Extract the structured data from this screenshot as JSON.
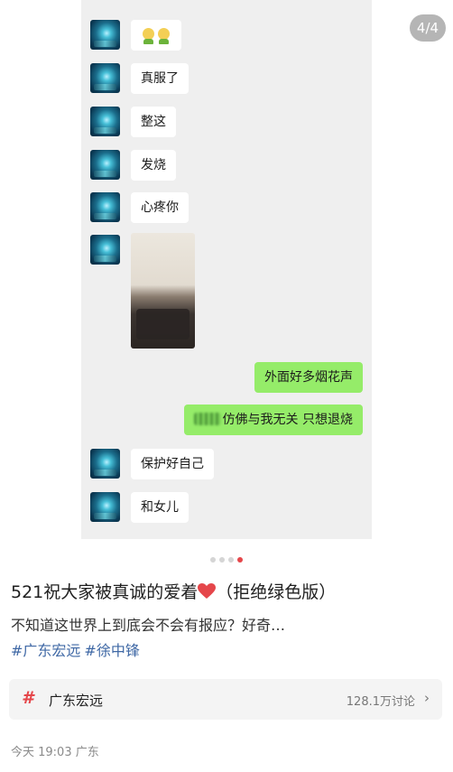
{
  "image": {
    "page_counter": "4/4",
    "messages": [
      {
        "side": "left",
        "type": "emoji",
        "emoji": "green-face-emoji"
      },
      {
        "side": "left",
        "type": "text",
        "text": "真服了"
      },
      {
        "side": "left",
        "type": "text",
        "text": "整这"
      },
      {
        "side": "left",
        "type": "text",
        "text": "发烧"
      },
      {
        "side": "left",
        "type": "text",
        "text": "心疼你"
      },
      {
        "side": "left",
        "type": "photo"
      },
      {
        "side": "right",
        "type": "text",
        "text": "外面好多烟花声"
      },
      {
        "side": "right",
        "type": "text",
        "text": "仿佛与我无关 只想退烧"
      },
      {
        "side": "left",
        "type": "text",
        "text": "保护好自己"
      },
      {
        "side": "left",
        "type": "text",
        "text": "和女儿"
      }
    ],
    "carousel": {
      "total": 4,
      "active": 4
    }
  },
  "post": {
    "title_before": "521祝大家被真诚的爱着",
    "title_after": "（拒绝绿色版）",
    "body": "不知道这世界上到底会不会有报应？好奇…",
    "tags": [
      "#广东宏远",
      "#徐中锋"
    ]
  },
  "topic": {
    "hash": "#",
    "name": "广东宏远",
    "count": "128.1万讨论",
    "chevron": "›"
  },
  "meta": {
    "time": "今天 19:03",
    "location": "广东"
  },
  "colors": {
    "accent": "#e5464a",
    "tag_blue": "#3f68a5",
    "bubble_green": "#95ec69"
  }
}
